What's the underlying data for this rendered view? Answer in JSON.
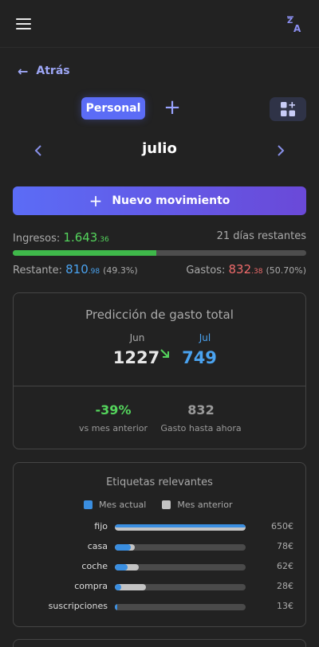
{
  "back_label": "Atrás",
  "personal_tab": "Personal",
  "month": "julio",
  "new_movement_label": "Nuevo movimiento",
  "summary": {
    "income_label": "Ingresos:",
    "income_int": "1.643",
    "income_dec": ".36",
    "days_left": "21 días restantes",
    "progress": 0.49,
    "remaining_label": "Restante:",
    "remaining_int": "810",
    "remaining_dec": ".98",
    "remaining_pct": "(49.3%)",
    "expenses_label": "Gastos:",
    "expenses_int": "832",
    "expenses_dec": ".38",
    "expenses_pct": "(50.70%)"
  },
  "prediction": {
    "title": "Predicción de gasto total",
    "prev_month": "Jun",
    "prev_value": "1227",
    "cur_month": "Jul",
    "cur_value": "749",
    "change_value": "-39%",
    "change_label": "vs mes anterior",
    "spent_value": "832",
    "spent_label": "Gasto hasta ahora"
  },
  "tags": {
    "title": "Etiquetas relevantes",
    "legend_current": "Mes actual",
    "legend_previous": "Mes anterior",
    "colors": {
      "current": "#3a8ee0",
      "previous": "#c3c3c3"
    },
    "rows": [
      {
        "label": "fijo",
        "value": "650€",
        "current": 1.0,
        "previous": 1.0
      },
      {
        "label": "casa",
        "value": "78€",
        "current": 0.12,
        "previous": 0.15
      },
      {
        "label": "coche",
        "value": "62€",
        "current": 0.1,
        "previous": 0.18
      },
      {
        "label": "compra",
        "value": "28€",
        "current": 0.05,
        "previous": 0.24
      },
      {
        "label": "suscripciones",
        "value": "13€",
        "current": 0.02,
        "previous": 0.02
      }
    ]
  }
}
